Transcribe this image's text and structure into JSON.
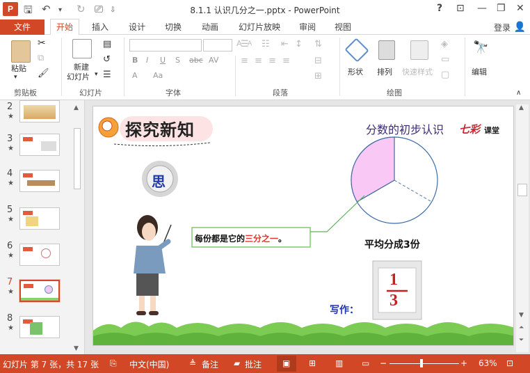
{
  "app": {
    "logo_letter": "P",
    "title": "8.1.1 认识几分之一.pptx - PowerPoint"
  },
  "window_buttons": {
    "help": "?",
    "ribbon_opts": "⊡",
    "minimize": "—",
    "restore": "❐",
    "close": "✕"
  },
  "menu": {
    "file": "文件",
    "tabs": [
      "开始",
      "插入",
      "设计",
      "切换",
      "动画",
      "幻灯片放映",
      "审阅",
      "视图"
    ],
    "active": "开始",
    "login": "登录"
  },
  "ribbon": {
    "clipboard": {
      "paste": "粘贴",
      "label": "剪贴板"
    },
    "slides": {
      "new_slide_l1": "新建",
      "new_slide_l2": "幻灯片",
      "label": "幻灯片"
    },
    "font": {
      "label": "字体",
      "bold": "B",
      "italic": "I",
      "underline": "U",
      "shadow": "S",
      "strike": "abc",
      "spacing": "AV",
      "case": "Aa",
      "grow": "A",
      "shrink": "A",
      "clear": "A"
    },
    "paragraph": {
      "label": "段落"
    },
    "drawing": {
      "shape": "形状",
      "arrange": "排列",
      "quick_style": "快速样式",
      "label": "绘图"
    },
    "editing": {
      "edit": "编辑"
    }
  },
  "slides_panel": {
    "items": [
      {
        "num": "2",
        "star": "★"
      },
      {
        "num": "3",
        "star": "★"
      },
      {
        "num": "4",
        "star": "★"
      },
      {
        "num": "5",
        "star": "★"
      },
      {
        "num": "6",
        "star": "★"
      },
      {
        "num": "7",
        "star": "★"
      },
      {
        "num": "8",
        "star": "★"
      }
    ],
    "selected": "7"
  },
  "slide": {
    "heading": "探究新知",
    "top_right": "分数的初步认识",
    "brand_1": "七彩",
    "brand_2": "课堂",
    "think_char": "思",
    "speech_prefix": "每份都是它的",
    "speech_highlight": "三分之一",
    "speech_suffix": "。",
    "caption": "平均分成3份",
    "write_label": "写作：",
    "frac_num": "1",
    "frac_den": "3",
    "colors": {
      "accent": "#d24726",
      "pie_fill": "#f9c8f4",
      "pie_stroke": "#3d6aa6",
      "highlight_text": "#e8332a"
    }
  },
  "status": {
    "slide_info": "幻灯片 第 7 张，共 17 张",
    "language": "中文(中国)",
    "notes": "备注",
    "comments": "批注",
    "zoom": "63%"
  }
}
